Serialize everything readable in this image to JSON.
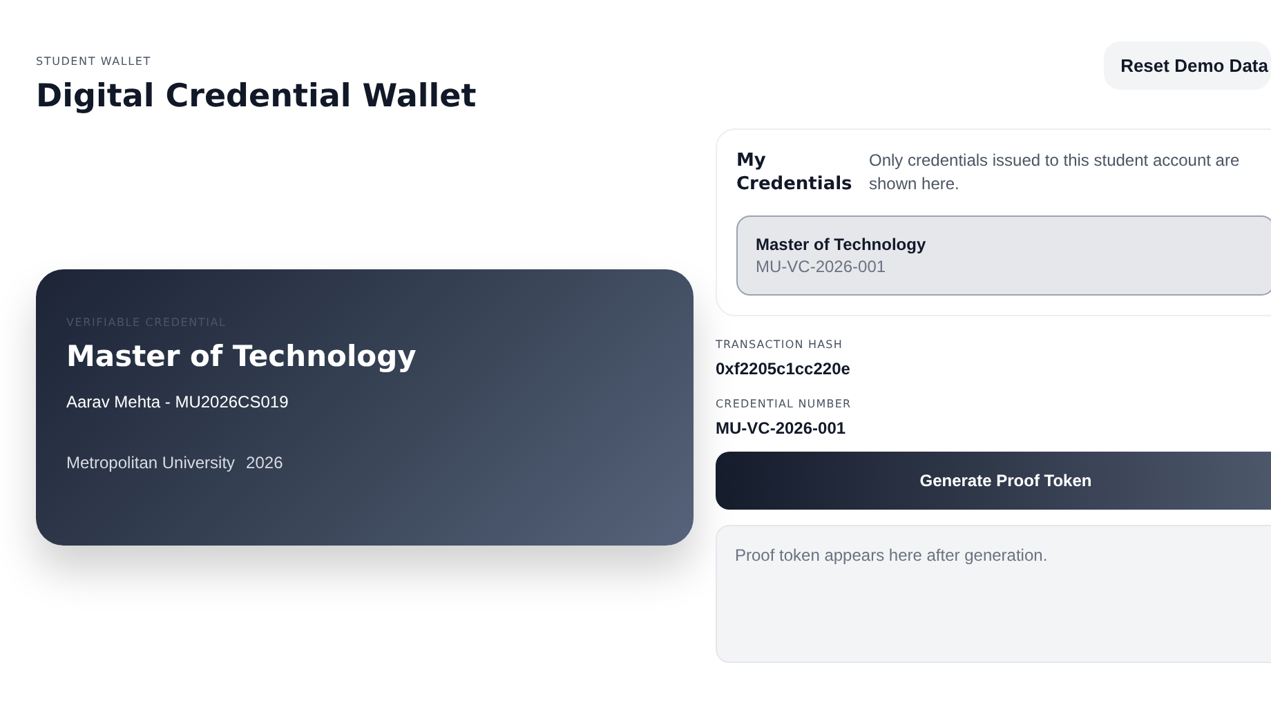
{
  "header": {
    "eyebrow": "STUDENT WALLET",
    "title": "Digital Credential Wallet",
    "reset_button": "Reset Demo Data"
  },
  "credential_card": {
    "eyebrow": "VERIFIABLE CREDENTIAL",
    "title": "Master of Technology",
    "holder": "Aarav Mehta - MU2026CS019",
    "issuer": "Metropolitan University",
    "year": "2026"
  },
  "credentials_panel": {
    "title": "My Credentials",
    "note": "Only credentials issued to this student account are shown here.",
    "items": [
      {
        "title": "Master of Technology",
        "number": "MU-VC-2026-001",
        "selected": true
      }
    ]
  },
  "details": [
    {
      "label": "TRANSACTION HASH",
      "value": "0xf2205c1cc220e"
    },
    {
      "label": "CREDENTIAL NUMBER",
      "value": "MU-VC-2026-001"
    }
  ],
  "generate_button": "Generate Proof Token",
  "proof_output": {
    "placeholder": "Proof token appears here after generation."
  }
}
